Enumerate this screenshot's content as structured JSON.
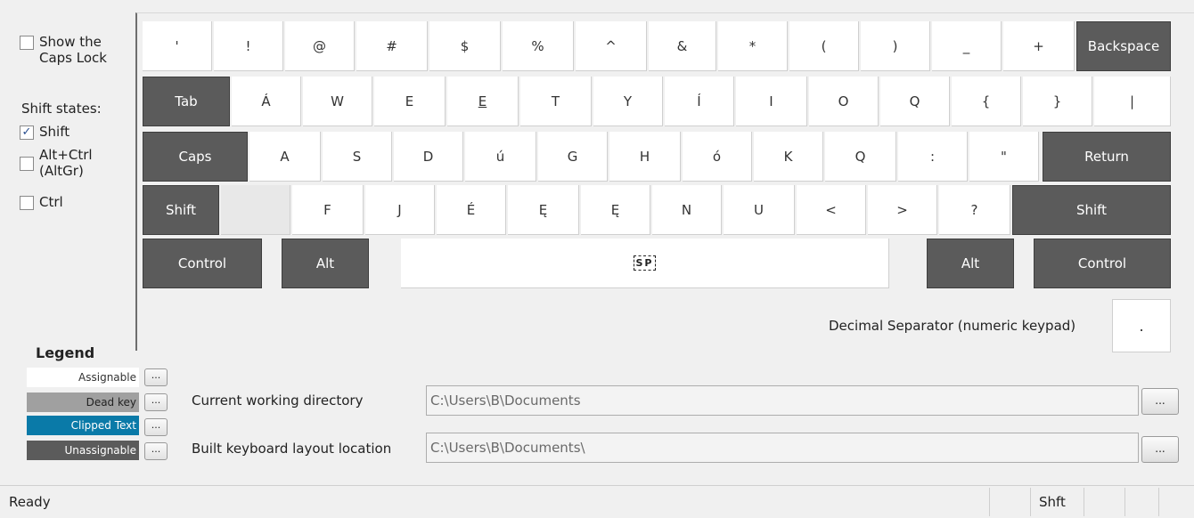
{
  "options": {
    "show_caps_lock": "Show the\nCaps Lock",
    "shift_states_title": "Shift states:",
    "shift": "Shift",
    "shift_checked": "✓",
    "altgr": "Alt+Ctrl\n(AltGr)",
    "ctrl": "Ctrl"
  },
  "keys": {
    "row1": [
      "'",
      "!",
      "@",
      "#",
      "$",
      "%",
      "^",
      "&",
      "*",
      "(",
      ")",
      "_",
      "+",
      "Backspace"
    ],
    "row2": [
      "Tab",
      "Á",
      "W",
      "E",
      "E",
      "T",
      "Y",
      "Í",
      "I",
      "O",
      "Q",
      "{",
      "}",
      "|"
    ],
    "row3": [
      "Caps",
      "A",
      "S",
      "D",
      "ú",
      "G",
      "H",
      "ó",
      "K",
      "Q",
      ":",
      "\"",
      "Return"
    ],
    "row4": [
      "Shift",
      "",
      "F",
      "J",
      "É",
      "Ę",
      "Ę",
      "N",
      "U",
      "<",
      ">",
      "?",
      "Shift"
    ],
    "row5": [
      "Control",
      "Alt",
      "SP",
      "Alt",
      "Control"
    ]
  },
  "decimal": {
    "label": "Decimal Separator (numeric keypad)",
    "value": "."
  },
  "legend": {
    "title": "Legend",
    "items": [
      {
        "label": "Assignable",
        "color": "#ffffff",
        "text_color": "#333333",
        "button": "..."
      },
      {
        "label": "Dead key",
        "color": "#a0a0a0",
        "text_color": "#222222",
        "button": "..."
      },
      {
        "label": "Clipped Text",
        "color": "#0a7aa8",
        "text_color": "#ffffff",
        "button": "..."
      },
      {
        "label": "Unassignable",
        "color": "#5b5b5b",
        "text_color": "#ffffff",
        "button": "..."
      }
    ]
  },
  "paths": {
    "cwd_label": "Current working directory",
    "cwd_value": "C:\\Users\\B\\Documents",
    "build_label": "Built keyboard layout location",
    "build_value": "C:\\Users\\B\\Documents\\",
    "browse": "..."
  },
  "status": {
    "text": "Ready",
    "shift_indicator": "Shft"
  }
}
